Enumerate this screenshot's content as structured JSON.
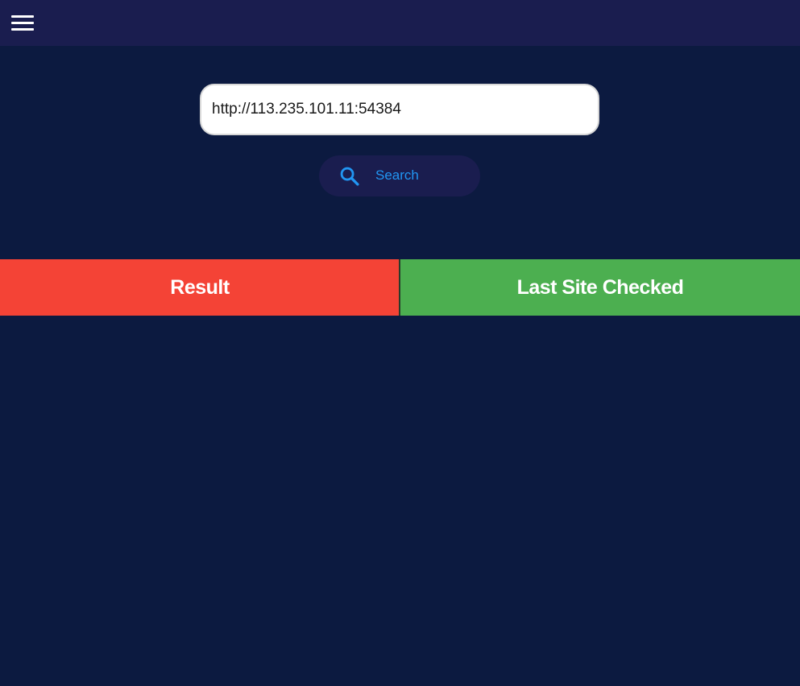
{
  "menu": {
    "icon": "menu-icon"
  },
  "url_input": {
    "value": "http://113.235.101.11:54384",
    "placeholder": ""
  },
  "search": {
    "label": "Search",
    "icon": "search-icon",
    "accent_color": "#2196f3"
  },
  "tabs": [
    {
      "label": "Result",
      "color": "#f44336"
    },
    {
      "label": "Last Site Checked",
      "color": "#4caf50"
    }
  ],
  "colors": {
    "background": "#0c1a40",
    "topbar": "#1a1d4f"
  }
}
